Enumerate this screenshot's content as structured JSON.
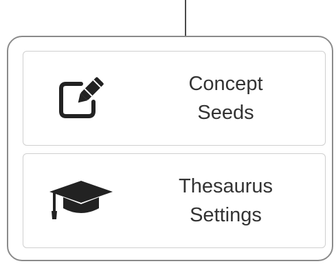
{
  "menu": {
    "items": [
      {
        "line1": "Concept",
        "line2": "Seeds",
        "icon": "edit-icon"
      },
      {
        "line1": "Thesaurus",
        "line2": "Settings",
        "icon": "graduation-cap-icon"
      }
    ]
  },
  "colors": {
    "text": "#333333",
    "icon": "#222222",
    "card_border": "#cfcfcf",
    "panel_border": "#8a8a8a"
  }
}
